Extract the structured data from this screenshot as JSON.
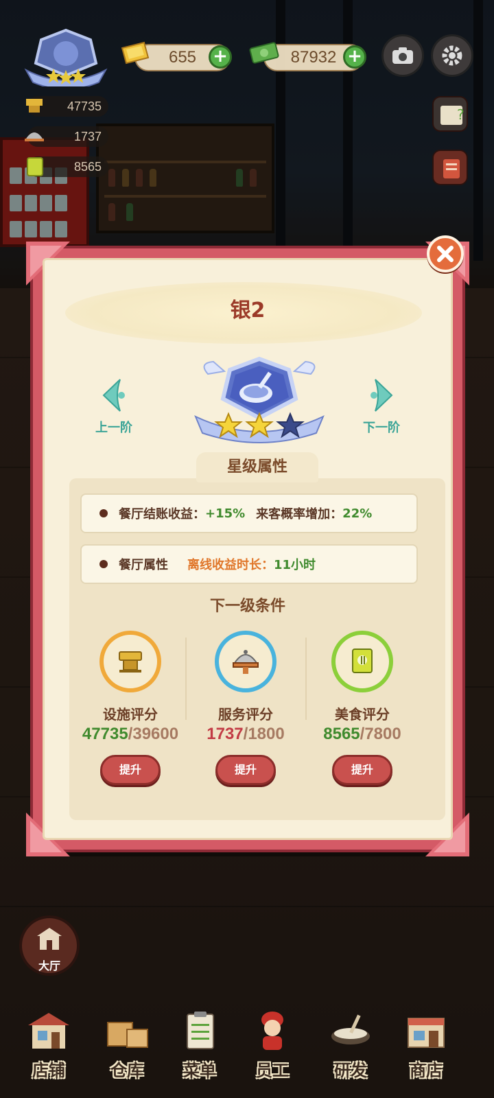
{
  "hud": {
    "gold": "655",
    "cash": "87932",
    "stats": [
      {
        "icon": "facility-icon",
        "value": "47735"
      },
      {
        "icon": "service-icon",
        "value": "1737"
      },
      {
        "icon": "food-icon",
        "value": "8565"
      }
    ]
  },
  "dialog": {
    "title": "银2",
    "prev_label": "上一阶",
    "next_label": "下一阶",
    "stars_filled": 2,
    "stars_total": 3,
    "section_title": "星级属性",
    "attr1": {
      "label1": "餐厅结账收益",
      "sep1": "：",
      "value1": "+15%",
      "label2": "来客概率增加",
      "sep2": "：",
      "value2": "22%"
    },
    "attr2": {
      "label": "餐厅属性",
      "sublabel": "离线收益时长",
      "sep": "：",
      "value": "11小时"
    },
    "cond_title": "下一级条件",
    "conditions": [
      {
        "name": "设施评分",
        "current": "47735",
        "required": "/39600",
        "met": true,
        "ring_color": "#f0a93a",
        "value_color": "#3f8a2d",
        "button": "提升"
      },
      {
        "name": "服务评分",
        "current": "1737",
        "required": "/1800",
        "met": false,
        "ring_color": "#49b3dd",
        "value_color": "#c23b45",
        "button": "提升"
      },
      {
        "name": "美食评分",
        "current": "8565",
        "required": "/7800",
        "met": true,
        "ring_color": "#8ccf3a",
        "value_color": "#3f8a2d",
        "button": "提升"
      }
    ]
  },
  "hall_label": "大厅",
  "nav": [
    {
      "label": "店铺",
      "icon": "shop-icon"
    },
    {
      "label": "仓库",
      "icon": "warehouse-icon"
    },
    {
      "label": "菜单",
      "icon": "menu-icon"
    },
    {
      "label": "员工",
      "icon": "staff-icon"
    },
    {
      "label": "研发",
      "icon": "research-icon"
    },
    {
      "label": "商店",
      "icon": "store-icon"
    }
  ],
  "colors": {
    "dialog_border": "#d45a66",
    "accent_teal": "#3aa497",
    "title_red": "#9b3a28"
  }
}
